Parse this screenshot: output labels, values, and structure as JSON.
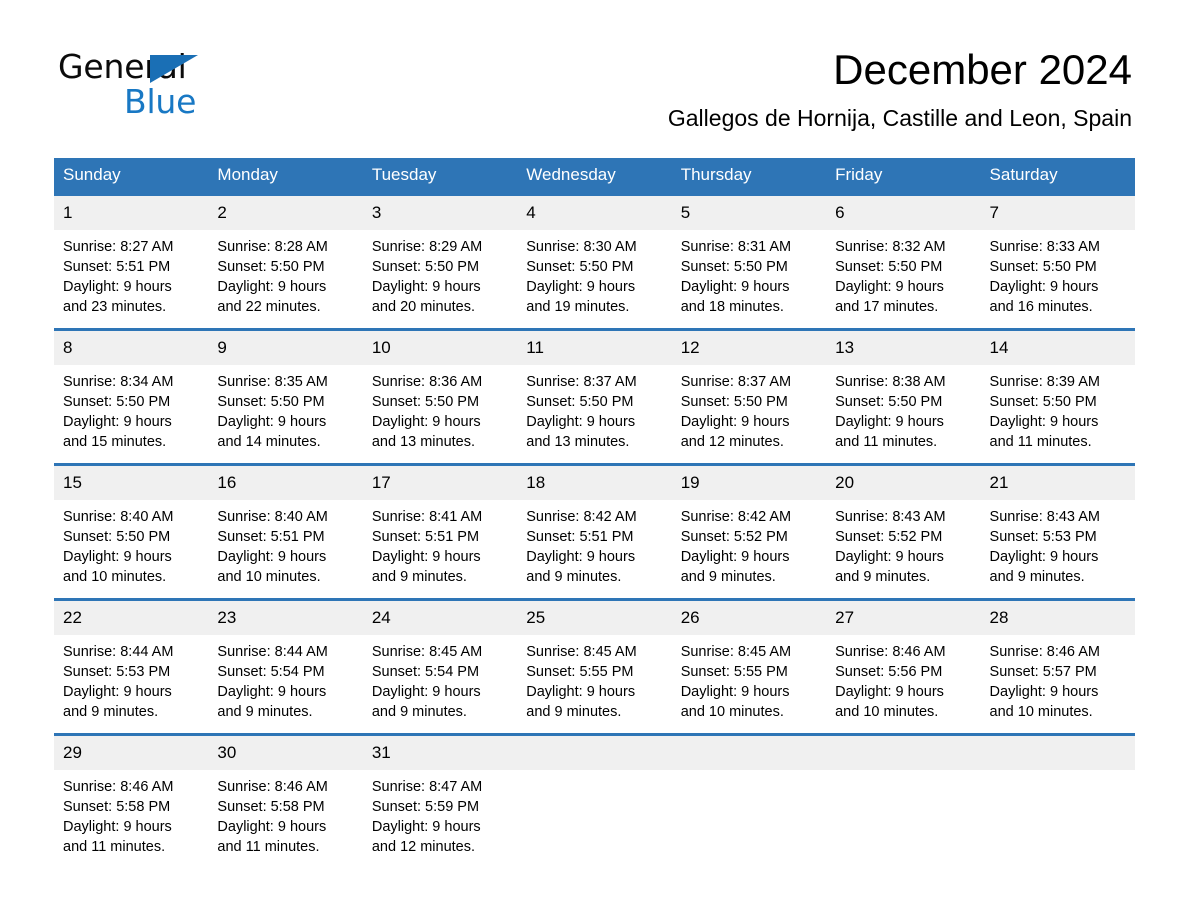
{
  "brand": {
    "name_part1": "General",
    "name_part2": "Blue"
  },
  "header": {
    "month_title": "December 2024",
    "location": "Gallegos de Hornija, Castille and Leon, Spain"
  },
  "colors": {
    "header_blue": "#2e75b6",
    "brand_blue": "#1878c4",
    "daynum_bg": "#f0f0f0",
    "page_bg": "#ffffff",
    "text": "#000000"
  },
  "calendar": {
    "weekdays": [
      "Sunday",
      "Monday",
      "Tuesday",
      "Wednesday",
      "Thursday",
      "Friday",
      "Saturday"
    ],
    "weeks": [
      [
        {
          "day": "1",
          "details": "Sunrise: 8:27 AM\nSunset: 5:51 PM\nDaylight: 9 hours\nand 23 minutes."
        },
        {
          "day": "2",
          "details": "Sunrise: 8:28 AM\nSunset: 5:50 PM\nDaylight: 9 hours\nand 22 minutes."
        },
        {
          "day": "3",
          "details": "Sunrise: 8:29 AM\nSunset: 5:50 PM\nDaylight: 9 hours\nand 20 minutes."
        },
        {
          "day": "4",
          "details": "Sunrise: 8:30 AM\nSunset: 5:50 PM\nDaylight: 9 hours\nand 19 minutes."
        },
        {
          "day": "5",
          "details": "Sunrise: 8:31 AM\nSunset: 5:50 PM\nDaylight: 9 hours\nand 18 minutes."
        },
        {
          "day": "6",
          "details": "Sunrise: 8:32 AM\nSunset: 5:50 PM\nDaylight: 9 hours\nand 17 minutes."
        },
        {
          "day": "7",
          "details": "Sunrise: 8:33 AM\nSunset: 5:50 PM\nDaylight: 9 hours\nand 16 minutes."
        }
      ],
      [
        {
          "day": "8",
          "details": "Sunrise: 8:34 AM\nSunset: 5:50 PM\nDaylight: 9 hours\nand 15 minutes."
        },
        {
          "day": "9",
          "details": "Sunrise: 8:35 AM\nSunset: 5:50 PM\nDaylight: 9 hours\nand 14 minutes."
        },
        {
          "day": "10",
          "details": "Sunrise: 8:36 AM\nSunset: 5:50 PM\nDaylight: 9 hours\nand 13 minutes."
        },
        {
          "day": "11",
          "details": "Sunrise: 8:37 AM\nSunset: 5:50 PM\nDaylight: 9 hours\nand 13 minutes."
        },
        {
          "day": "12",
          "details": "Sunrise: 8:37 AM\nSunset: 5:50 PM\nDaylight: 9 hours\nand 12 minutes."
        },
        {
          "day": "13",
          "details": "Sunrise: 8:38 AM\nSunset: 5:50 PM\nDaylight: 9 hours\nand 11 minutes."
        },
        {
          "day": "14",
          "details": "Sunrise: 8:39 AM\nSunset: 5:50 PM\nDaylight: 9 hours\nand 11 minutes."
        }
      ],
      [
        {
          "day": "15",
          "details": "Sunrise: 8:40 AM\nSunset: 5:50 PM\nDaylight: 9 hours\nand 10 minutes."
        },
        {
          "day": "16",
          "details": "Sunrise: 8:40 AM\nSunset: 5:51 PM\nDaylight: 9 hours\nand 10 minutes."
        },
        {
          "day": "17",
          "details": "Sunrise: 8:41 AM\nSunset: 5:51 PM\nDaylight: 9 hours\nand 9 minutes."
        },
        {
          "day": "18",
          "details": "Sunrise: 8:42 AM\nSunset: 5:51 PM\nDaylight: 9 hours\nand 9 minutes."
        },
        {
          "day": "19",
          "details": "Sunrise: 8:42 AM\nSunset: 5:52 PM\nDaylight: 9 hours\nand 9 minutes."
        },
        {
          "day": "20",
          "details": "Sunrise: 8:43 AM\nSunset: 5:52 PM\nDaylight: 9 hours\nand 9 minutes."
        },
        {
          "day": "21",
          "details": "Sunrise: 8:43 AM\nSunset: 5:53 PM\nDaylight: 9 hours\nand 9 minutes."
        }
      ],
      [
        {
          "day": "22",
          "details": "Sunrise: 8:44 AM\nSunset: 5:53 PM\nDaylight: 9 hours\nand 9 minutes."
        },
        {
          "day": "23",
          "details": "Sunrise: 8:44 AM\nSunset: 5:54 PM\nDaylight: 9 hours\nand 9 minutes."
        },
        {
          "day": "24",
          "details": "Sunrise: 8:45 AM\nSunset: 5:54 PM\nDaylight: 9 hours\nand 9 minutes."
        },
        {
          "day": "25",
          "details": "Sunrise: 8:45 AM\nSunset: 5:55 PM\nDaylight: 9 hours\nand 9 minutes."
        },
        {
          "day": "26",
          "details": "Sunrise: 8:45 AM\nSunset: 5:55 PM\nDaylight: 9 hours\nand 10 minutes."
        },
        {
          "day": "27",
          "details": "Sunrise: 8:46 AM\nSunset: 5:56 PM\nDaylight: 9 hours\nand 10 minutes."
        },
        {
          "day": "28",
          "details": "Sunrise: 8:46 AM\nSunset: 5:57 PM\nDaylight: 9 hours\nand 10 minutes."
        }
      ],
      [
        {
          "day": "29",
          "details": "Sunrise: 8:46 AM\nSunset: 5:58 PM\nDaylight: 9 hours\nand 11 minutes."
        },
        {
          "day": "30",
          "details": "Sunrise: 8:46 AM\nSunset: 5:58 PM\nDaylight: 9 hours\nand 11 minutes."
        },
        {
          "day": "31",
          "details": "Sunrise: 8:47 AM\nSunset: 5:59 PM\nDaylight: 9 hours\nand 12 minutes."
        },
        {
          "day": "",
          "details": ""
        },
        {
          "day": "",
          "details": ""
        },
        {
          "day": "",
          "details": ""
        },
        {
          "day": "",
          "details": ""
        }
      ]
    ]
  }
}
